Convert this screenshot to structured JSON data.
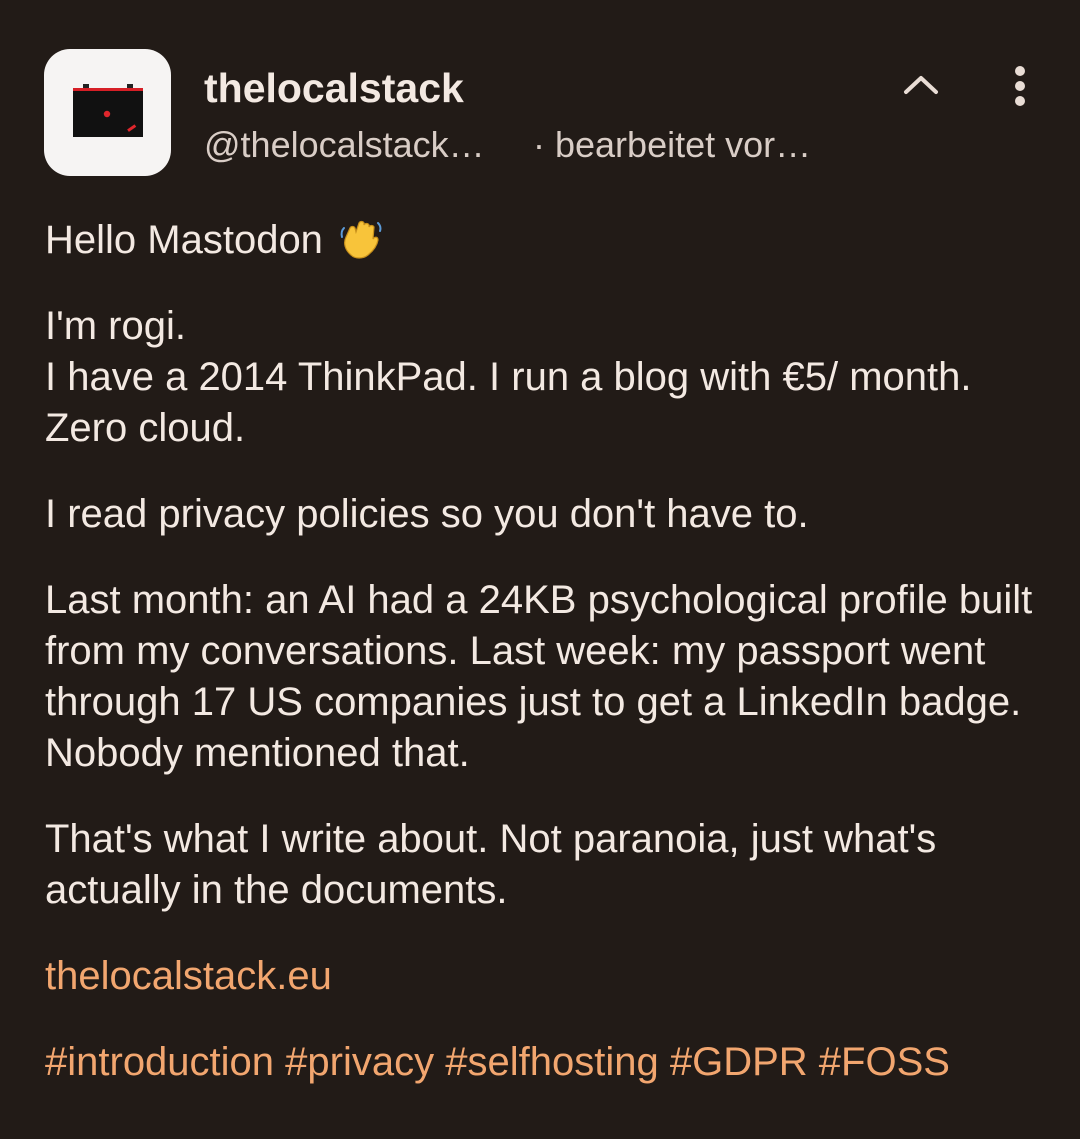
{
  "post": {
    "author": {
      "display_name": "thelocalstack",
      "handle": "@thelocalstack…",
      "avatar_icon": "laptop-logo"
    },
    "timestamp": "· bearbeitet vor…",
    "actions": {
      "collapse_icon": "chevron-up-icon",
      "more_icon": "more-vertical-icon"
    },
    "body": {
      "greeting": "Hello Mastodon",
      "greeting_emoji": "waving-hand",
      "intro_line1": "I'm rogi.",
      "intro_line2": "I have a 2014 ThinkPad. I run a blog with €5/ month. Zero cloud.",
      "para2": "I read privacy policies so you don't have to.",
      "para3": "Last month: an AI had a 24KB psychological profile built from my conversations. Last week: my passport went through 17 US companies just to get a LinkedIn badge. Nobody mentioned that.",
      "para4": "That's what I write about. Not paranoia, just what's actually in the documents.",
      "link": "thelocalstack.eu"
    },
    "hashtags": [
      "#introduction",
      "#privacy",
      "#selfhosting",
      "#GDPR",
      "#FOSS"
    ]
  },
  "colors": {
    "background": "#221b17",
    "text": "#f3e9e2",
    "secondary_text": "#d9cdc6",
    "accent": "#f2a66f",
    "avatar_bg": "#f6f4f3"
  }
}
